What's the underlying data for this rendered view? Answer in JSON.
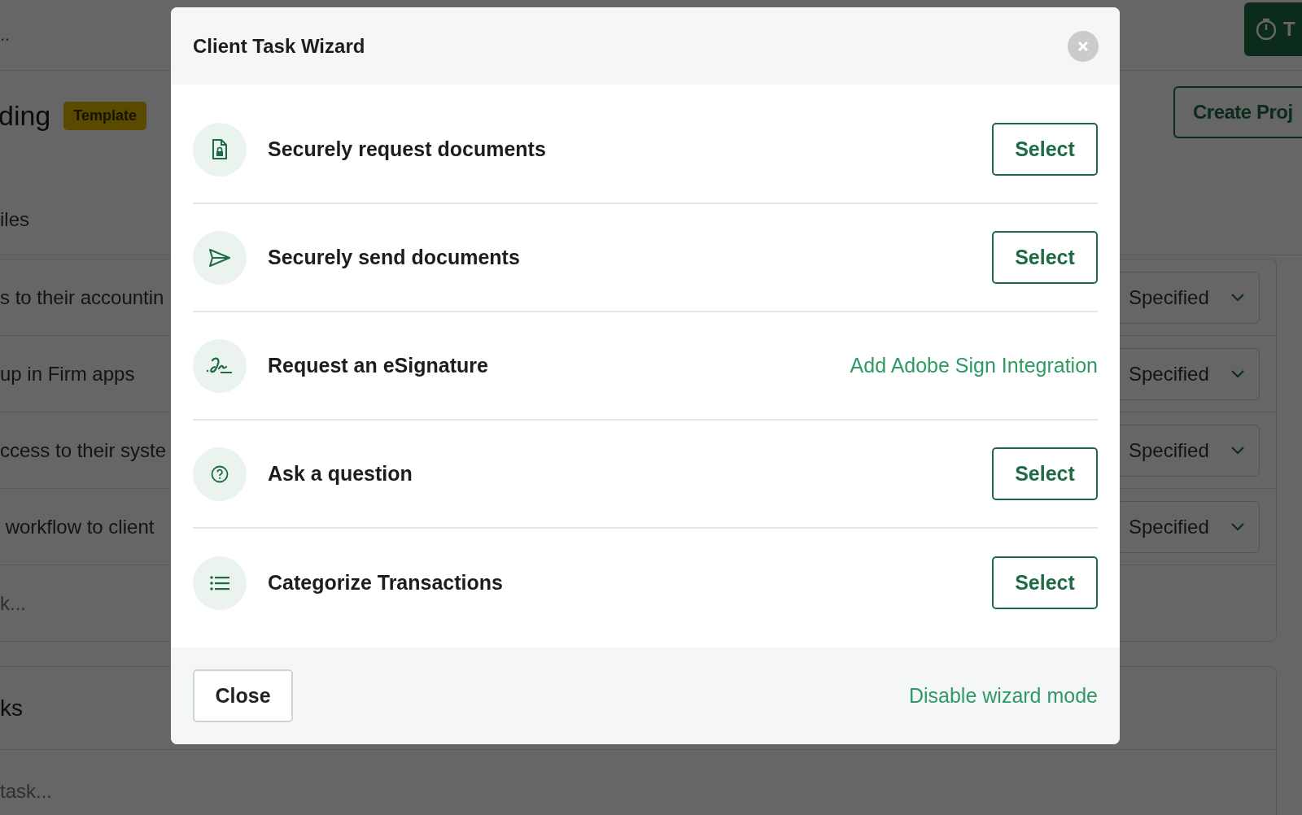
{
  "background": {
    "top_bar": {
      "breadcrumb": "..",
      "timer_button": "T"
    },
    "header": {
      "title": "ding",
      "badge": "Template",
      "create_button": "Create Proj"
    },
    "tabs": [
      {
        "label": "iles"
      }
    ],
    "tasks": [
      {
        "text": "s to their accountin",
        "assignee": "Specified"
      },
      {
        "text": "up in Firm apps",
        "assignee": "Specified"
      },
      {
        "text": "ccess to their syste",
        "assignee": "Specified"
      },
      {
        "text": " workflow to client",
        "assignee": "Specified"
      }
    ],
    "add_task": {
      "placeholder": "k..."
    },
    "second_section": {
      "title": "ks",
      "add_task": {
        "placeholder": "task..."
      }
    }
  },
  "modal": {
    "title": "Client Task Wizard",
    "options": [
      {
        "label": "Securely request documents",
        "kind": "button",
        "action": "Select"
      },
      {
        "label": "Securely send documents",
        "kind": "button",
        "action": "Select"
      },
      {
        "label": "Request an eSignature",
        "kind": "link",
        "action": "Add Adobe Sign Integration"
      },
      {
        "label": "Ask a question",
        "kind": "button",
        "action": "Select"
      },
      {
        "label": "Categorize Transactions",
        "kind": "button",
        "action": "Select"
      }
    ],
    "footer": {
      "close_button": "Close",
      "link": "Disable wizard mode"
    }
  }
}
